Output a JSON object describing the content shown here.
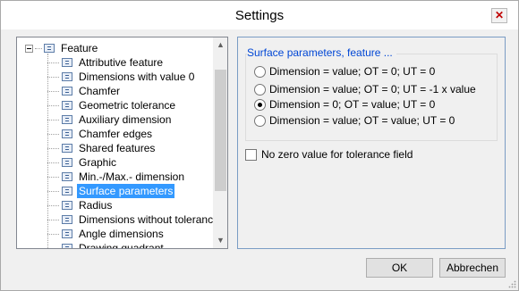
{
  "window": {
    "title": "Settings"
  },
  "tree": {
    "root_label": "Feature",
    "items": [
      {
        "label": "Attributive feature"
      },
      {
        "label": "Dimensions with value 0"
      },
      {
        "label": "Chamfer"
      },
      {
        "label": "Geometric tolerance"
      },
      {
        "label": "Auxiliary dimension"
      },
      {
        "label": "Chamfer edges"
      },
      {
        "label": "Shared features"
      },
      {
        "label": "Graphic"
      },
      {
        "label": "Min.-/Max.- dimension"
      },
      {
        "label": "Surface parameters",
        "selected": true
      },
      {
        "label": "Radius"
      },
      {
        "label": "Dimensions without tolerance"
      },
      {
        "label": "Angle dimensions"
      },
      {
        "label": "Drawing quadrant"
      }
    ]
  },
  "panel": {
    "group_title": "Surface parameters, feature ...",
    "options": [
      {
        "label": "Dimension = value; OT = 0; UT = 0",
        "checked": false
      },
      {
        "label": "Dimension = value; OT = 0; UT = -1 x value",
        "checked": false
      },
      {
        "label": "Dimension = 0; OT = value; UT = 0",
        "checked": true
      },
      {
        "label": "Dimension = value; OT = value; UT = 0",
        "checked": false
      }
    ],
    "checkbox_label": "No zero value for tolerance field",
    "checkbox_checked": false
  },
  "buttons": {
    "ok": "OK",
    "cancel": "Abbrechen"
  },
  "icons": {
    "close": "close-icon",
    "scroll_up": "scroll-up-icon",
    "scroll_down": "scroll-down-icon",
    "node": "settings-node-icon"
  }
}
